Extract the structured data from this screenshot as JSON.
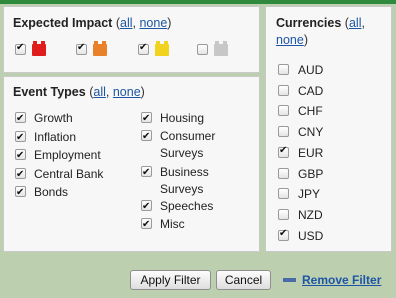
{
  "impact": {
    "title": "Expected Impact",
    "paren_open": "(",
    "all": "all",
    "comma": ",",
    "none": "none",
    "paren_close": ")",
    "levels": [
      {
        "name": "high",
        "checked": true,
        "color": "#e01d1d"
      },
      {
        "name": "medium",
        "checked": true,
        "color": "#e9812a"
      },
      {
        "name": "low",
        "checked": true,
        "color": "#f1d21c"
      },
      {
        "name": "none",
        "checked": false,
        "color": "#c7c7c7"
      }
    ]
  },
  "event_types": {
    "title": "Event Types",
    "paren_open": "(",
    "all": "all",
    "comma": ",",
    "none": "none",
    "paren_close": ")",
    "left_items": [
      {
        "label": "Growth",
        "checked": true
      },
      {
        "label": "Inflation",
        "checked": true
      },
      {
        "label": "Employment",
        "checked": true
      },
      {
        "label": "Central Bank",
        "checked": true
      },
      {
        "label": "Bonds",
        "checked": true
      }
    ],
    "right_items": [
      {
        "label": "Housing",
        "checked": true
      },
      {
        "label": "Consumer",
        "label2": "Surveys",
        "checked": true
      },
      {
        "label": "Business",
        "label2": "Surveys",
        "checked": true
      },
      {
        "label": "Speeches",
        "checked": true
      },
      {
        "label": "Misc",
        "checked": true
      }
    ]
  },
  "currencies": {
    "title": "Currencies",
    "paren_open": "(",
    "all": "all",
    "comma": ",",
    "none": "none",
    "paren_close": ")",
    "items": [
      {
        "code": "AUD",
        "checked": false
      },
      {
        "code": "CAD",
        "checked": false
      },
      {
        "code": "CHF",
        "checked": false
      },
      {
        "code": "CNY",
        "checked": false
      },
      {
        "code": "EUR",
        "checked": true
      },
      {
        "code": "GBP",
        "checked": false
      },
      {
        "code": "JPY",
        "checked": false
      },
      {
        "code": "NZD",
        "checked": false
      },
      {
        "code": "USD",
        "checked": true
      }
    ]
  },
  "footer": {
    "apply_label": "Apply Filter",
    "cancel_label": "Cancel",
    "remove_label": "Remove Filter"
  }
}
